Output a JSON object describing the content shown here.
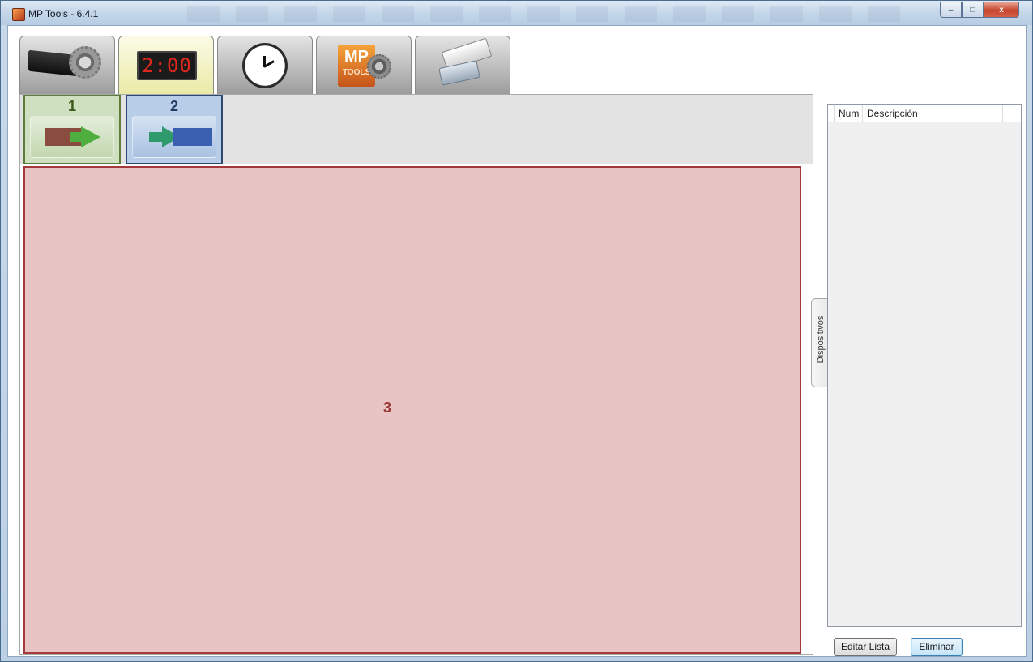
{
  "window": {
    "title": "MP Tools - 6.4.1",
    "controls": {
      "minimize": "–",
      "maximize": "□",
      "close": "x"
    }
  },
  "main_tabs": [
    {
      "name": "settings",
      "icon": "display-gear-icon",
      "active": false
    },
    {
      "name": "display",
      "icon": "led-display-icon",
      "display_text": "2:00",
      "active": true
    },
    {
      "name": "clock",
      "icon": "clock-icon",
      "active": false
    },
    {
      "name": "mptools",
      "icon": "mp-tools-logo-icon",
      "logo_top": "MP",
      "logo_bottom": "TOOLS",
      "active": false
    },
    {
      "name": "network",
      "icon": "network-serial-icon",
      "active": false
    }
  ],
  "sub_tabs": [
    {
      "number": "1",
      "icon": "display-to-arrow-icon",
      "color": "#cfe0c0"
    },
    {
      "number": "2",
      "icon": "arrow-to-display-icon",
      "color": "#b8cde8"
    }
  ],
  "work_area": {
    "label": "3",
    "color": "#e8c4c4"
  },
  "side_panel_tab": {
    "label": "Dispositivos"
  },
  "device_list": {
    "columns": [
      "Num",
      "Descripción"
    ],
    "rows": []
  },
  "buttons": {
    "edit": "Editar Lista",
    "delete": "Eliminar"
  }
}
